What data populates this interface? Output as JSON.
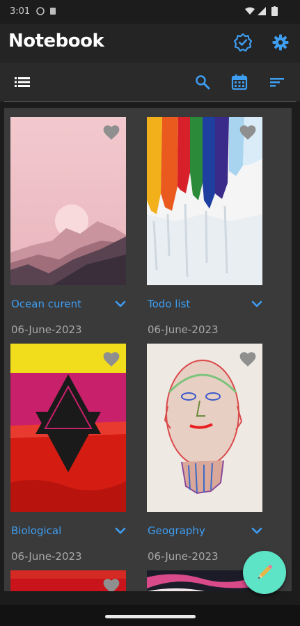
{
  "status_bar": {
    "time": "3:01"
  },
  "app_bar": {
    "title": "Notebook",
    "icons": [
      "verified-icon",
      "gear-icon"
    ],
    "accent": "#3e9ef2"
  },
  "toolbar": {
    "icons": [
      "list-view-icon",
      "search-icon",
      "calendar-icon",
      "sort-icon"
    ]
  },
  "notes": [
    {
      "title": "Ocean curent",
      "date": "06-June-2023",
      "favorite": false
    },
    {
      "title": "Todo list",
      "date": "06-June-2023",
      "favorite": false
    },
    {
      "title": "Biological",
      "date": "06-June-2023",
      "favorite": false
    },
    {
      "title": "Geography",
      "date": "06-June-2023",
      "favorite": false
    }
  ],
  "fab": {
    "icon": "pencil-icon",
    "color": "#5de3c6"
  }
}
